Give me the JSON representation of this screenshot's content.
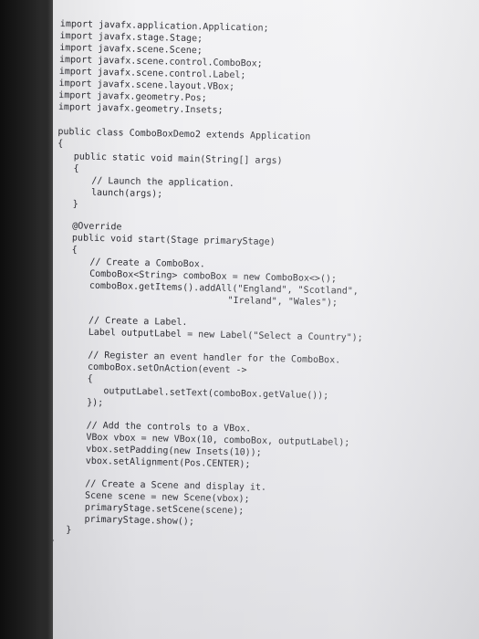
{
  "editor": {
    "lines": [
      "import javafx.application.Application;",
      "import javafx.stage.Stage;",
      "import javafx.scene.Scene;",
      "import javafx.scene.control.ComboBox;",
      "import javafx.scene.control.Label;",
      "import javafx.scene.layout.VBox;",
      "import javafx.geometry.Pos;",
      "import javafx.geometry.Insets;",
      "public class ComboBoxDemo2 extends Application",
      "{",
      "public static void main(String[] args)",
      "{",
      "// Launch the application.",
      "launch(args);",
      "}",
      "@Override",
      "public void start(Stage primaryStage)",
      "{",
      "// Create a ComboBox.",
      "ComboBox<String> comboBox = new ComboBox<>();",
      "comboBox.getItems().addAll(\"England\", \"Scotland\",",
      "\"Ireland\", \"Wales\");",
      "// Create a Label.",
      "Label outputLabel = new Label(\"Select a Country\");",
      "// Register an event handler for the ComboBox.",
      "comboBox.setOnAction(event ->",
      "{",
      "outputLabel.setText(comboBox.getValue());",
      "});",
      "// Add the controls to a VBox.",
      "VBox vbox = new VBox(10, comboBox, outputLabel);",
      "vbox.setPadding(new Insets(10));",
      "vbox.setAlignment(Pos.CENTER);",
      "// Create a Scene and display it.",
      "Scene scene = new Scene(vbox);",
      "primaryStage.setScene(scene);",
      "primaryStage.show();",
      "}",
      "}"
    ]
  }
}
